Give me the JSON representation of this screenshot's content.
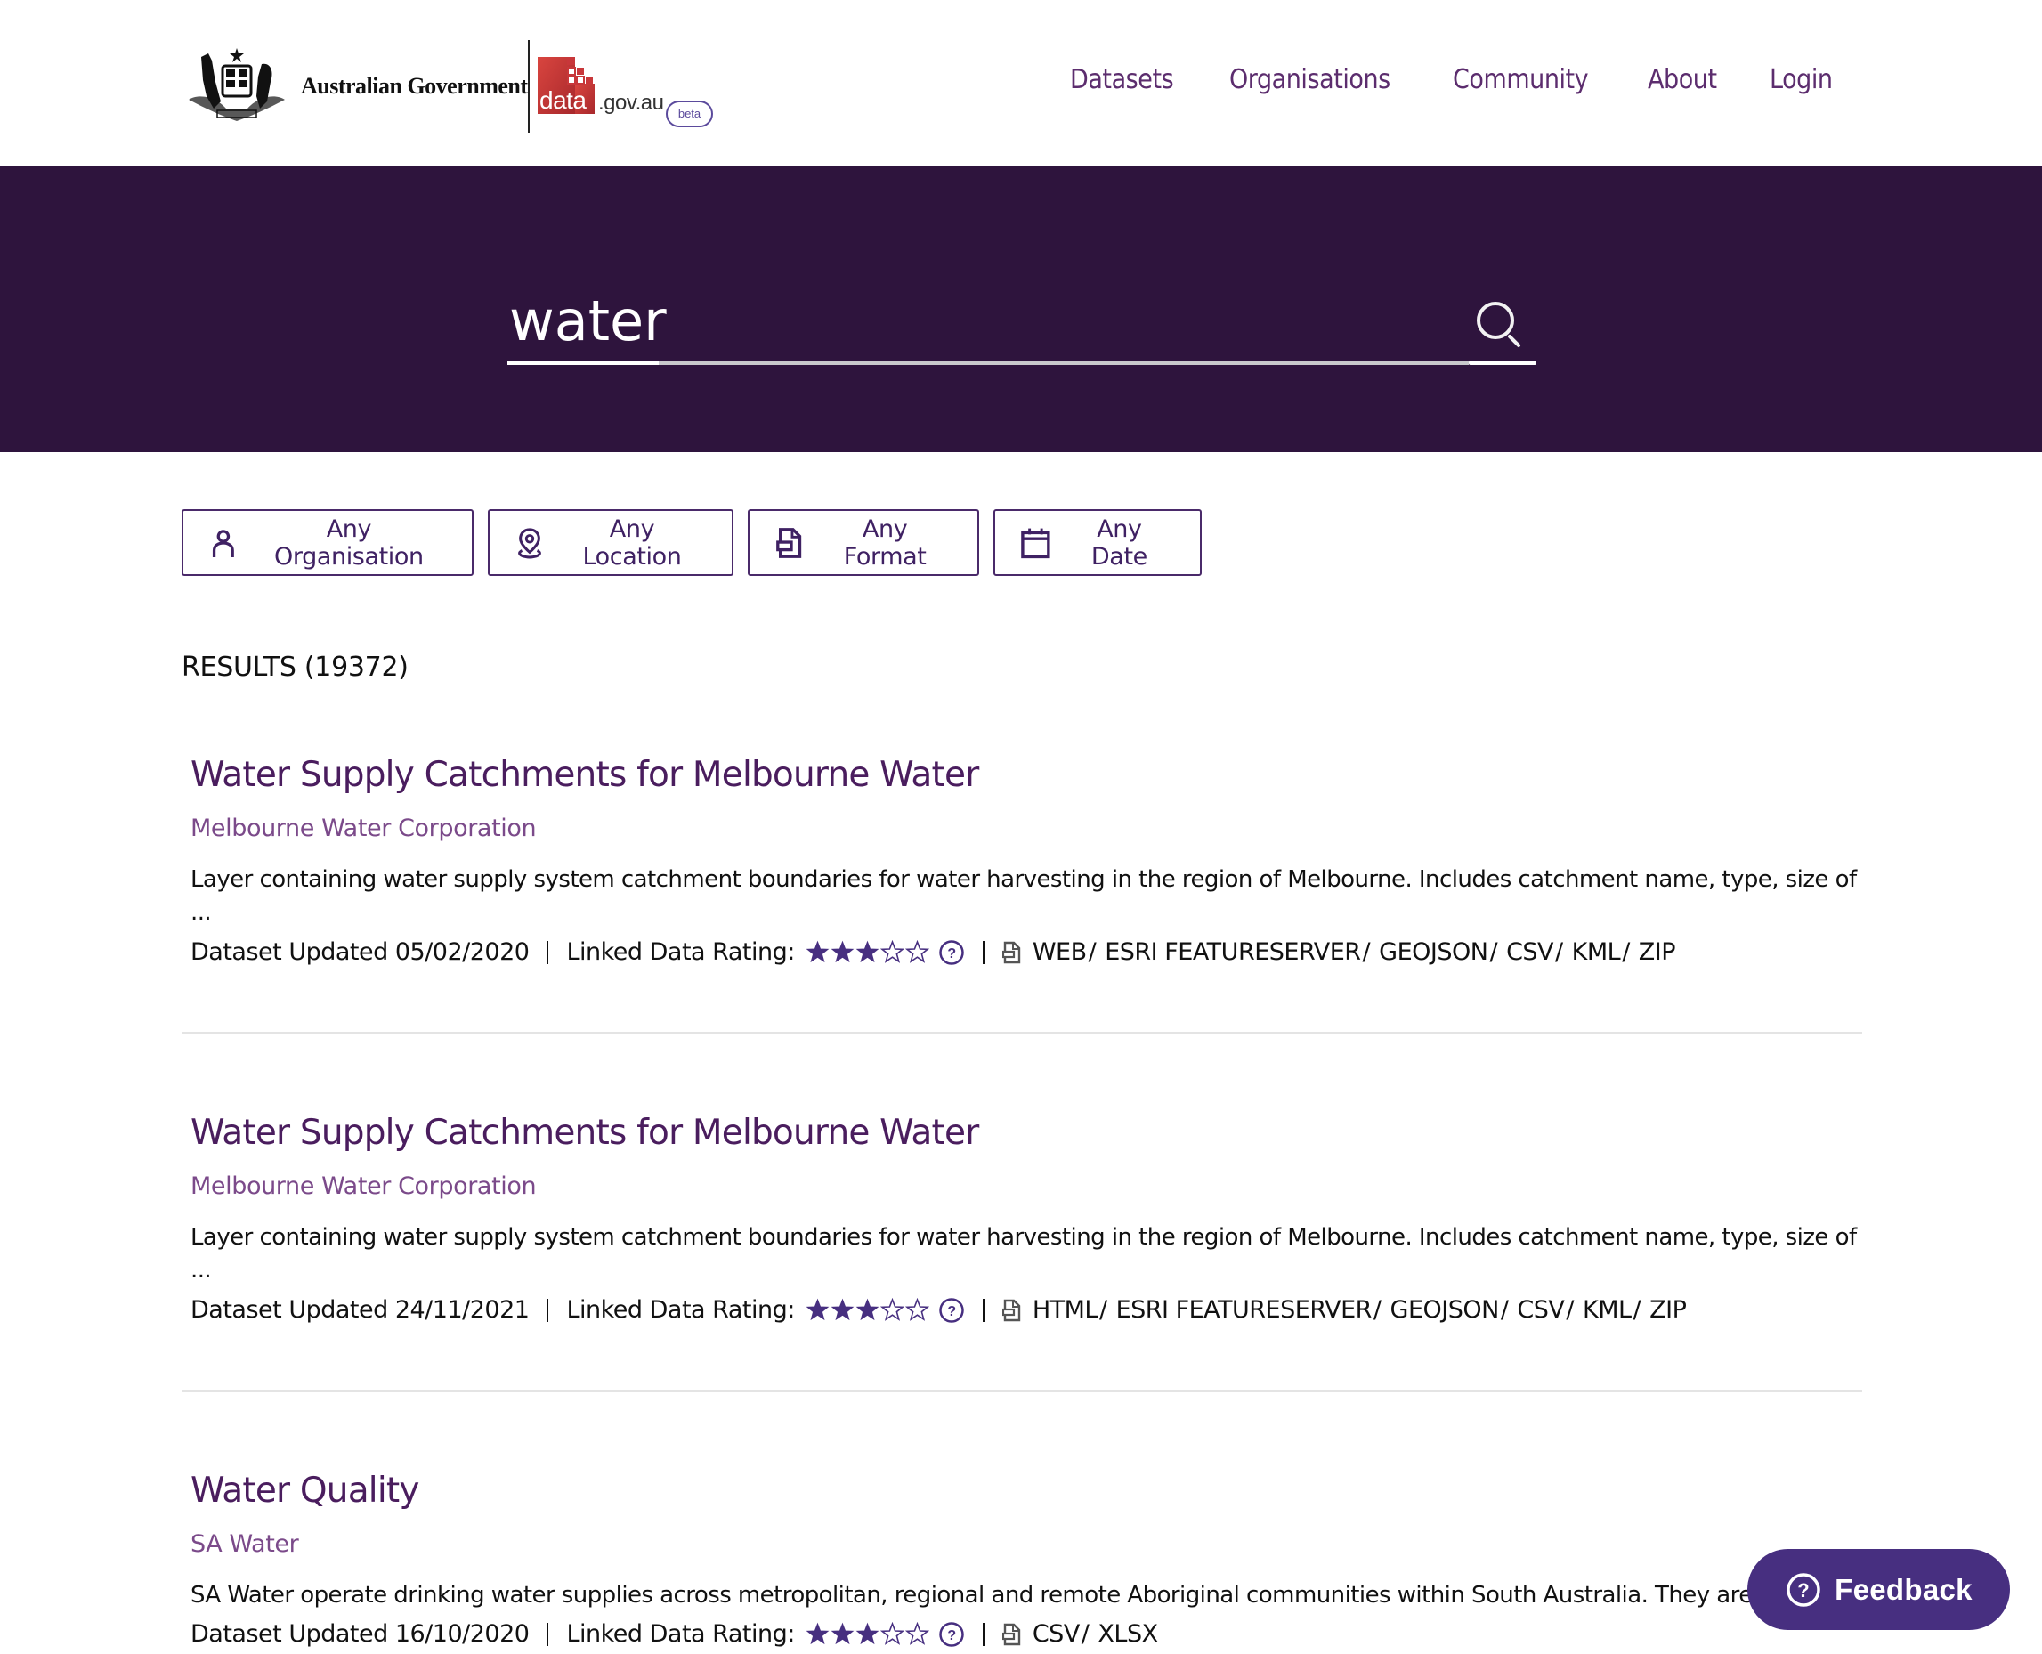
{
  "header": {
    "gov_name": "Australian Government",
    "site_logo_word": "data",
    "site_logo_domain": ".gov.au",
    "beta_label": "beta",
    "nav": [
      {
        "label": "Datasets"
      },
      {
        "label": "Organisations"
      },
      {
        "label": "Community"
      },
      {
        "label": "About"
      },
      {
        "label": "Login"
      }
    ]
  },
  "search": {
    "value": "water",
    "icon": "search-icon"
  },
  "filters": [
    {
      "label": "Any Organisation",
      "icon": "person-icon"
    },
    {
      "label": "Any Location",
      "icon": "location-pin-icon"
    },
    {
      "label": "Any Format",
      "icon": "document-icon"
    },
    {
      "label": "Any Date",
      "icon": "calendar-icon"
    }
  ],
  "results": {
    "count_label": "RESULTS (19372)",
    "items": [
      {
        "title": "Water Supply Catchments for Melbourne Water",
        "organisation": "Melbourne Water Corporation",
        "description": "Layer containing water supply system catchment boundaries for water harvesting in the region of Melbourne. Includes catchment name, type, size of",
        "description_more": "...",
        "updated": "Dataset Updated 05/02/2020",
        "rating_label": "Linked Data Rating:",
        "rating": 3,
        "rating_max": 5,
        "formats": [
          "WEB",
          "ESRI FEATURESERVER",
          "GEOJSON",
          "CSV",
          "KML",
          "ZIP"
        ]
      },
      {
        "title": "Water Supply Catchments for Melbourne Water",
        "organisation": "Melbourne Water Corporation",
        "description": "Layer containing water supply system catchment boundaries for water harvesting in the region of Melbourne. Includes catchment name, type, size of",
        "description_more": "...",
        "updated": "Dataset Updated 24/11/2021",
        "rating_label": "Linked Data Rating:",
        "rating": 3,
        "rating_max": 5,
        "formats": [
          "HTML",
          "ESRI FEATURESERVER",
          "GEOJSON",
          "CSV",
          "KML",
          "ZIP"
        ]
      },
      {
        "title": "Water Quality",
        "organisation": "SA Water",
        "description": "SA Water operate drinking water supplies across metropolitan, regional and remote Aboriginal communities within South Australia. They are",
        "description_more": "",
        "updated": "Dataset Updated 16/10/2020",
        "rating_label": "Linked Data Rating:",
        "rating": 3,
        "rating_max": 5,
        "formats": [
          "CSV",
          "XLSX"
        ]
      }
    ]
  },
  "feedback": {
    "label": "Feedback"
  },
  "colors": {
    "brand_dark": "#2e143d",
    "link_purple": "#4a1d5e",
    "org_purple": "#7b4a8a",
    "accent": "#472f80",
    "star": "#472f80",
    "data_logo_red": "#c8373a"
  }
}
